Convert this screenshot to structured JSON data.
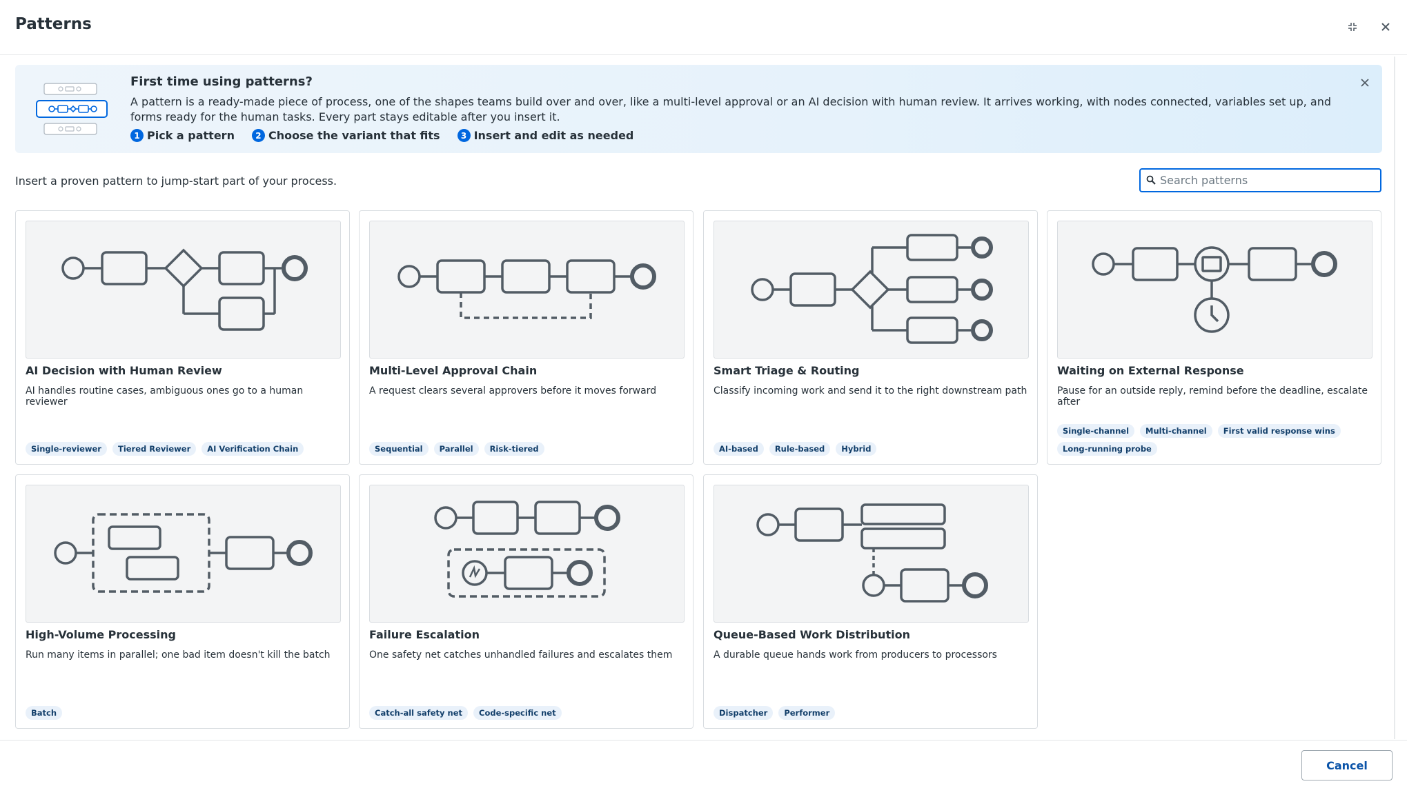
{
  "header": {
    "title": "Patterns"
  },
  "banner": {
    "title": "First time using patterns?",
    "description": "A pattern is a ready-made piece of process, one of the shapes teams build over and over, like a multi-level approval or an AI decision with human review. It arrives working, with nodes connected, variables set up, and forms ready for the human tasks. Every part stays editable after you insert it.",
    "steps": [
      {
        "num": "1",
        "label": "Pick a pattern"
      },
      {
        "num": "2",
        "label": "Choose the variant that fits"
      },
      {
        "num": "3",
        "label": "Insert and edit as needed"
      }
    ]
  },
  "intro": "Insert a proven pattern to jump-start part of your process.",
  "search": {
    "placeholder": "Search patterns",
    "value": ""
  },
  "cards": [
    {
      "title": "AI Decision with Human Review",
      "description": "AI handles routine cases, ambiguous ones go to a human reviewer",
      "tags": [
        "Single-reviewer",
        "Tiered Reviewer",
        "AI Verification Chain"
      ]
    },
    {
      "title": "Multi-Level Approval Chain",
      "description": "A request clears several approvers before it moves forward",
      "tags": [
        "Sequential",
        "Parallel",
        "Risk-tiered"
      ]
    },
    {
      "title": "Smart Triage & Routing",
      "description": "Classify incoming work and send it to the right downstream path",
      "tags": [
        "AI-based",
        "Rule-based",
        "Hybrid"
      ]
    },
    {
      "title": "Waiting on External Response",
      "description": "Pause for an outside reply, remind before the deadline, escalate after",
      "tags": [
        "Single-channel",
        "Multi-channel",
        "First valid response wins",
        "Long-running probe"
      ]
    },
    {
      "title": "High-Volume Processing",
      "description": "Run many items in parallel; one bad item doesn't kill the batch",
      "tags": [
        "Batch"
      ]
    },
    {
      "title": "Failure Escalation",
      "description": "One safety net catches unhandled failures and escalates them",
      "tags": [
        "Catch-all safety net",
        "Code-specific net"
      ]
    },
    {
      "title": "Queue-Based Work Distribution",
      "description": "A durable queue hands work from producers to processors",
      "tags": [
        "Dispatcher",
        "Performer"
      ]
    }
  ],
  "footer": {
    "cancel_label": "Cancel"
  },
  "colors": {
    "accent": "#0067df",
    "diagram_stroke": "#525c65",
    "tag_bg": "#e9f1fa",
    "banner_bg": "#e6f2fb"
  },
  "icons": [
    "collapse-icon",
    "close-icon",
    "search-icon",
    "pattern-illustration"
  ]
}
